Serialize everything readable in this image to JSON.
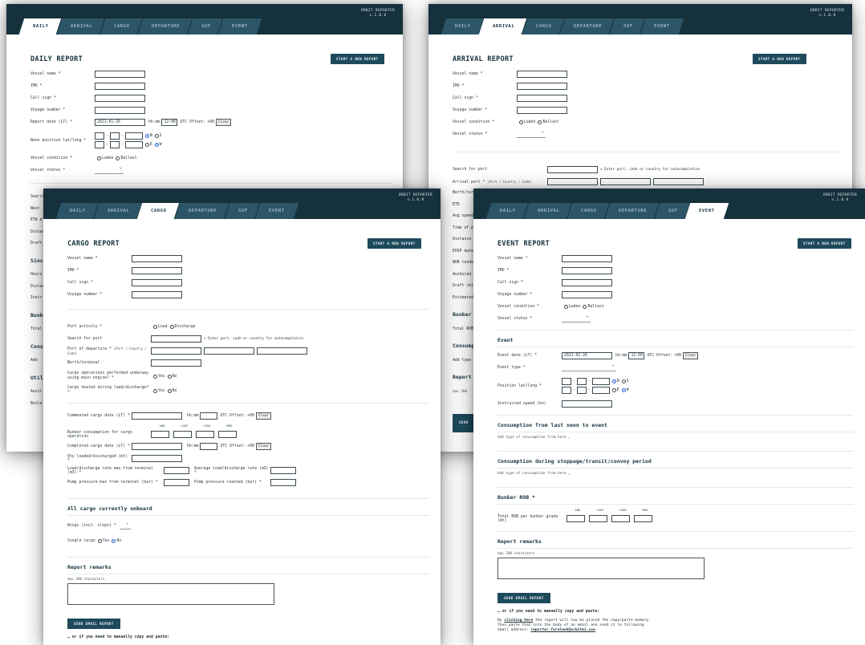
{
  "app": {
    "name": "ORBIT REPORTER",
    "version": "v.1.0.8"
  },
  "tabs": [
    "DAILY",
    "ARRIVAL",
    "CARGO",
    "DEPARTURE",
    "SOF",
    "EVENT"
  ],
  "common": {
    "start_new": "START A NEW REPORT",
    "vessel_name": "Vessel name *",
    "imo": "IMO *",
    "call_sign": "Call sign *",
    "voyage_number": "Voyage number *",
    "vessel_condition": "Vessel condition *",
    "laden": "Laden",
    "ballast": "Ballast",
    "vessel_status": "Vessel status *",
    "hhmm": "hh:mm",
    "utc_offset": "UTC Offset:",
    "utc_val": "+00",
    "clear": "Clear",
    "date_val": "2021-01-26",
    "time_val": "12:00",
    "n": "N",
    "s": "S",
    "e": "E",
    "w": "W"
  },
  "daily": {
    "title": "DAILY REPORT",
    "report_date": "Report date (LT) *",
    "noon_position": "Noon position lat/long *",
    "bits": [
      "Search",
      "Next",
      "ETA d",
      "Distan",
      "Draft",
      "Sinc",
      "Hours",
      "Distan",
      "Instr",
      "Bunke",
      "Total",
      "Cons",
      "Add",
      "Util",
      "Auxil",
      "Boile"
    ]
  },
  "arrival": {
    "title": "ARRIVAL REPORT",
    "search_port": "Search for port",
    "search_hint": "« Enter port, code or country for autocompletion",
    "arrival_port": "Arrival port *",
    "arrival_port_sub": "(Port / Country / Code)",
    "bits": [
      "Berth/ter",
      "ETD",
      "Avg speed",
      "Time of p",
      "Distance",
      "EOSP date",
      "NOR tende",
      "Anchored",
      "Draft (m)",
      "Estimated",
      "Bunker",
      "Total ROB",
      "Consump",
      "Add type",
      "Report",
      "max 200",
      "SEND"
    ]
  },
  "cargo": {
    "title": "CARGO REPORT",
    "port_activity": "Port activity *",
    "load": "Load",
    "discharge": "Discharge",
    "search_port": "Search for port",
    "search_hint": "« Enter port, code or country for autocompletion",
    "port_departure": "Port of departure *",
    "port_departure_sub": "(Port / Country / Code)",
    "berth": "Berth/terminal",
    "ops_main_engine": "Cargo operations performed underway using main engine? *",
    "cargo_heated": "Cargo heated during load/discharge? *",
    "yes": "Yes",
    "no": "No",
    "commenced": "Commenced cargo date (LT) *",
    "bunker_consumption": "Bunker consumption for cargo operation",
    "grades": [
      "LNG",
      "LSGF",
      "LSGO",
      "MGO"
    ],
    "completed": "Completed cargo date (LT) *",
    "qty": "Qty loaded/discharged (mt) *",
    "max_rate": "Load/discharge rate max from terminal (m3) *",
    "avg_rate": "Average load/discharge rate (m3) *",
    "pump_max": "Pump pressure max from terminal (bar) *",
    "pump_reached": "Pump pressure reached (bar) *",
    "all_cargo": "All cargo currently onboard",
    "wings": "Wings (incl. slops) *",
    "single_cargo": "Single cargo",
    "remarks": "Report remarks",
    "max_chars": "max 200 characters",
    "send": "SEND EMAIL REPORT",
    "manual": "… or if you need to manually copy and paste:"
  },
  "event": {
    "title": "EVENT REPORT",
    "event_sect": "Event",
    "event_date": "Event date (LT) *",
    "event_type": "Event type *",
    "position": "Position lat/long *",
    "instructed_speed": "Instructed speed (kn)",
    "cons_noon": "Consumption from last noon to event",
    "add_type": "Add type of consumption from here",
    "cons_stoppage": "Consumption during stoppage/transit/convoy period",
    "bunker_rob": "Bunker ROB *",
    "grades": [
      "LNG",
      "LSGF",
      "LSGO",
      "MGO"
    ],
    "total_rob": "Total ROB per bunker grade (mt)",
    "remarks": "Report remarks",
    "max_chars": "max 200 characters",
    "send": "SEND EMAIL REPORT",
    "manual": "… or if you need to manually copy and paste:",
    "copy_pre": "By ",
    "copy_link": "clicking here",
    "copy_post": " the report will now be placed the copy/paste memory.",
    "copy_line2": "Then paste that into the body of an email and send it to following",
    "copy_line3": "email address: ",
    "email": "reporter.furetank@orbitmi.com"
  }
}
